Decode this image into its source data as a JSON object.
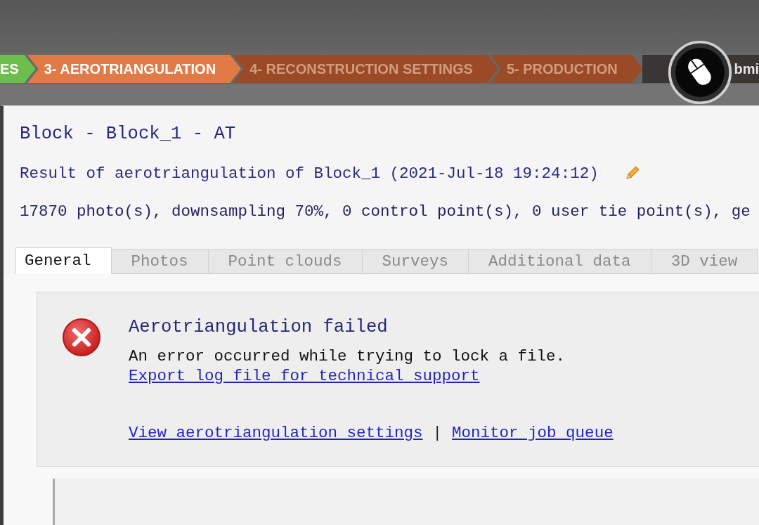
{
  "workflow_steps": [
    {
      "label": "ES",
      "kind": "done",
      "selected": false
    },
    {
      "label": "3- AEROTRIANGULATION",
      "kind": "todo",
      "selected": true
    },
    {
      "label": "4- RECONSTRUCTION SETTINGS",
      "kind": "todo",
      "selected": false
    },
    {
      "label": "5- PRODUCTION",
      "kind": "todo",
      "selected": false
    },
    {
      "label": "bmi",
      "kind": "submit",
      "selected": false
    }
  ],
  "block": {
    "title": "Block - Block_1 - AT",
    "result": "Result of aerotriangulation of Block_1 (2021-Jul-18 19:24:12)",
    "summary": "17870 photo(s), downsampling 70%, 0 control point(s), 0 user tie point(s), ge"
  },
  "tabs": [
    {
      "label": "General",
      "selected": true
    },
    {
      "label": "Photos",
      "selected": false
    },
    {
      "label": "Point clouds",
      "selected": false
    },
    {
      "label": "Surveys",
      "selected": false
    },
    {
      "label": "Additional data",
      "selected": false
    },
    {
      "label": "3D view",
      "selected": false
    }
  ],
  "error": {
    "title": "Aerotriangulation failed",
    "message": "An error occurred while trying to lock a file.",
    "export_link": "Export log file for technical support",
    "links": [
      "View aerotriangulation settings",
      "Monitor job queue"
    ],
    "separator": "|"
  }
}
